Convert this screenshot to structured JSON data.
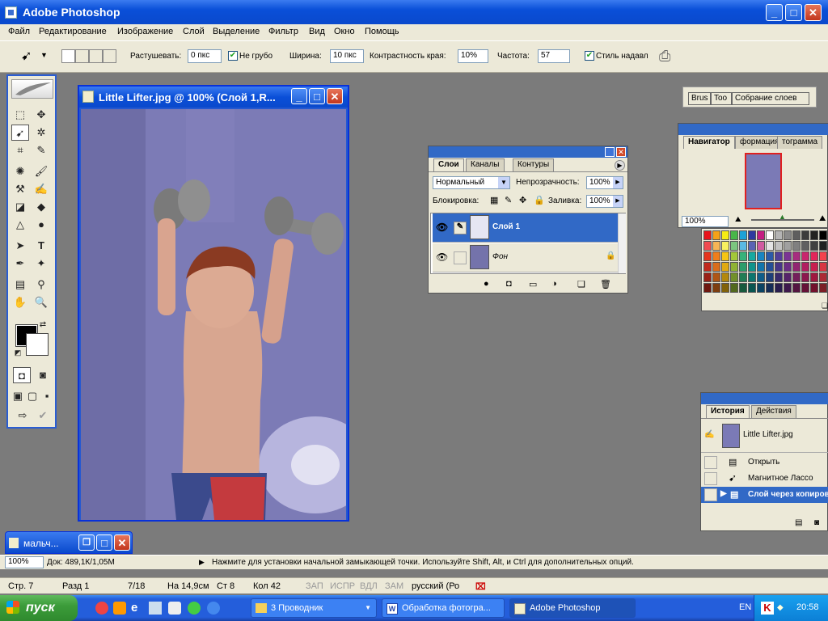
{
  "app": {
    "title": "Adobe Photoshop"
  },
  "menu": [
    "Файл",
    "Редактирование",
    "Изображение",
    "Слой",
    "Выделение",
    "Фильтр",
    "Вид",
    "Окно",
    "Помощь"
  ],
  "options": {
    "feather_label": "Растушевать:",
    "feather_value": "0 пкс",
    "antialias_label": "Не грубо",
    "width_label": "Ширина:",
    "width_value": "10 пкс",
    "contrast_label": "Контрастность края:",
    "contrast_value": "10%",
    "frequency_label": "Частота:",
    "frequency_value": "57",
    "pressure_label": "Стиль надавл",
    "well_tabs": [
      "Brus",
      "Too",
      "Собрание слоев"
    ]
  },
  "document": {
    "title": "Little Lifter.jpg @ 100% (Слой 1,R..."
  },
  "minimized_doc": {
    "title": "мальч..."
  },
  "layers_panel": {
    "tabs": [
      "Слои",
      "Каналы",
      "Контуры"
    ],
    "blend_mode": "Нормальный",
    "opacity_label": "Непрозрачность:",
    "opacity_value": "100%",
    "lock_label": "Блокировка:",
    "fill_label": "Заливка:",
    "fill_value": "100%",
    "layers": [
      {
        "name": "Слой 1",
        "active": true
      },
      {
        "name": "Фон",
        "active": false
      }
    ]
  },
  "navigator_panel": {
    "tabs": [
      "Навигатор",
      "формация",
      "тограмма"
    ],
    "zoom": "100%"
  },
  "history_panel": {
    "tabs": [
      "История",
      "Действия"
    ],
    "snapshot": "Little Lifter.jpg",
    "steps": [
      "Открыть",
      "Магнитное Лассо",
      "Слой через копиров"
    ]
  },
  "status": {
    "zoom": "100%",
    "doc_info": "Док: 489,1К/1,05М",
    "hint": "Нажмите для установки начальной замыкающей точки. Используйте Shift, Alt, и Ctrl для дополнительных опций."
  },
  "word_status": {
    "page": "Стр. 7",
    "section": "Разд 1",
    "pages": "7/18",
    "at": "На 14,9см",
    "line": "Ст 8",
    "col": "Кол 42",
    "rec": "ЗАП",
    "trk": "ИСПР",
    "ext": "ВДЛ",
    "ovr": "ЗАМ",
    "lang": "русский (Ро"
  },
  "taskbar": {
    "start": "пуск",
    "items": [
      "3 Проводник",
      "Обработка фотогра...",
      "Adobe Photoshop"
    ],
    "lang": "EN",
    "clock": "20:58"
  },
  "swatch_colors": [
    [
      "#e8141b",
      "#f5a117",
      "#f7ed15",
      "#48b649",
      "#1da2d8",
      "#2d3aa0",
      "#c41e82",
      "#ffffff",
      "#b4b4b4",
      "#8a8a8a",
      "#5e5e5e",
      "#3c3c3c",
      "#222",
      "#000",
      "#555",
      "#888",
      "#aaa",
      "#ccc"
    ],
    [
      "#f04b50",
      "#f6b556",
      "#f8f05f",
      "#7cc67f",
      "#5ab9e3",
      "#5a63b4",
      "#d05aa0",
      "#e4e4e4",
      "#c2c2c2",
      "#a0a0a0",
      "#808080",
      "#606060",
      "#404040",
      "#202020",
      "#777",
      "#999",
      "#bbb",
      "#ddd"
    ],
    [
      "#e5351c",
      "#ef7e1c",
      "#f6c515",
      "#a3c83a",
      "#37b27a",
      "#16a9a0",
      "#1885c2",
      "#2b5aa8",
      "#523f98",
      "#7b3494",
      "#a72d7f",
      "#c8266d",
      "#e2265a",
      "#f3424c",
      "#c9a46a",
      "#a57f4e",
      "#7f5c3a",
      "#5b3d25"
    ],
    [
      "#c12a1c",
      "#d86d1c",
      "#e0aa12",
      "#8fb233",
      "#2b9c6b",
      "#0f948c",
      "#1275ac",
      "#244f96",
      "#473587",
      "#6b2d84",
      "#922670",
      "#b11f60",
      "#c71f4f",
      "#d73542",
      "#b08f5b",
      "#8d6d42",
      "#6b4d31",
      "#4b321f"
    ],
    [
      "#9a2116",
      "#ae5616",
      "#b3880e",
      "#72902a",
      "#227d55",
      "#0b766f",
      "#0e5d8a",
      "#1d3f79",
      "#392a6c",
      "#56236a",
      "#741e5a",
      "#8c184d",
      "#9f183f",
      "#ab2a35",
      "#8c7249",
      "#705735",
      "#553d27",
      "#3b2818"
    ],
    [
      "#6e170f",
      "#7d3e10",
      "#81620a",
      "#52681e",
      "#185a3d",
      "#085550",
      "#0a4363",
      "#152d57",
      "#291e4e",
      "#3e194c",
      "#541540",
      "#651137",
      "#72112d",
      "#7b1e26",
      "#655234",
      "#503e26",
      "#3d2c1c",
      "#2a1c11"
    ]
  ]
}
